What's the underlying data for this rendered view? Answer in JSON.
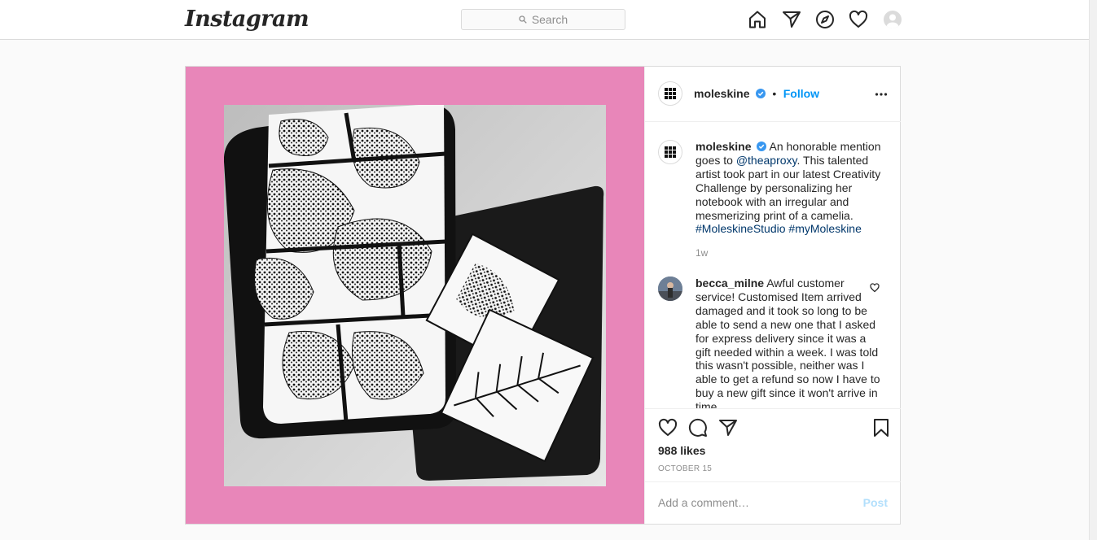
{
  "header": {
    "logo": "Instagram",
    "search_placeholder": "Search",
    "nav_icons": [
      "home-icon",
      "direct-icon",
      "explore-icon",
      "activity-icon",
      "profile-avatar"
    ]
  },
  "post": {
    "author": "moleskine",
    "follow_label": "Follow",
    "separator": "•",
    "caption": {
      "username": "moleskine",
      "text_before_mention": "An honorable mention goes to",
      "mention": "@theaproxy",
      "text_after_mention": ". This talented artist took part in our latest Creativity Challenge by personalizing her notebook with an irregular and mesmerizing print of a camelia.",
      "hashtag_1": "#MoleskineStudio",
      "hashtag_2": "#myMoleskine",
      "time": "1w"
    },
    "comments": [
      {
        "username": "becca_milne",
        "text": "Awful customer service! Customised Item arrived damaged and it took so long to be able to send a new one that I asked for express delivery since it was a gift needed within a week. I was told this wasn't possible, neither was I able to get a refund so now I have to buy a new gift since it won't arrive in time."
      }
    ],
    "likes": "988 likes",
    "date": "OCTOBER 15",
    "add_comment_placeholder": "Add a comment…",
    "post_button": "Post"
  },
  "colors": {
    "accent": "#0095f6",
    "media_background": "#e886b9",
    "verified": "#3897f0"
  }
}
